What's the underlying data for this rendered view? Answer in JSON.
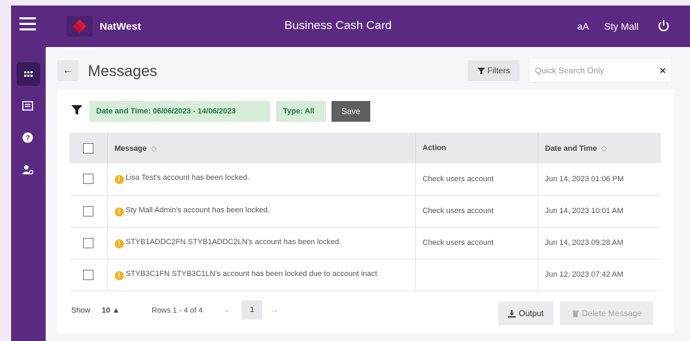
{
  "header": {
    "brand": "NatWest",
    "app_title": "Business Cash Card",
    "font_size_toggle": "aA",
    "user_name": "Sty Mall"
  },
  "sidebar": {
    "items": [
      {
        "icon": "grid-icon",
        "active": true
      },
      {
        "icon": "card-list-icon",
        "active": false
      },
      {
        "icon": "help-icon",
        "active": false
      },
      {
        "icon": "user-settings-icon",
        "active": false
      }
    ]
  },
  "page": {
    "back_arrow": "←",
    "title": "Messages",
    "filters_label": "Filters",
    "search_placeholder": "Quick Search Only",
    "search_clear": "×"
  },
  "filters": {
    "date_chip": "Date and Time: 06/06/2023 - 14/06/2023",
    "type_chip": "Type: All",
    "save_label": "Save"
  },
  "table": {
    "columns": {
      "message": "Message",
      "action": "Action",
      "date": "Date and Time",
      "sort_glyph": "◇"
    },
    "rows": [
      {
        "message": "Lisa Test's account has been locked.",
        "action": "Check users account",
        "date": "Jun 14, 2023 01:06 PM"
      },
      {
        "message": "Sty Mall Admin's account has been locked.",
        "action": "Check users account",
        "date": "Jun 14, 2023 10:01 AM"
      },
      {
        "message": "STYB1ADDC2FN STYB1ADDC2LN's account has been locked.",
        "action": "Check users account",
        "date": "Jun 14, 2023 09:28 AM"
      },
      {
        "message": "STYB3C1FN STYB3C1LN's account has been locked due to account inact",
        "action": "",
        "date": "Jun 12, 2023 07:42 AM"
      }
    ]
  },
  "footer": {
    "show_label": "Show",
    "show_value": "10 ▲",
    "rows_info": "Rows 1 - 4 of 4",
    "prev": "←",
    "page": "1",
    "next": "→",
    "output_label": "Output",
    "delete_label": "Delete Message"
  },
  "colors": {
    "brand_purple": "#5a2a82",
    "chip_green_bg": "#d7ecd9",
    "chip_green_text": "#1e7a3a",
    "warning": "#f4b01e"
  }
}
